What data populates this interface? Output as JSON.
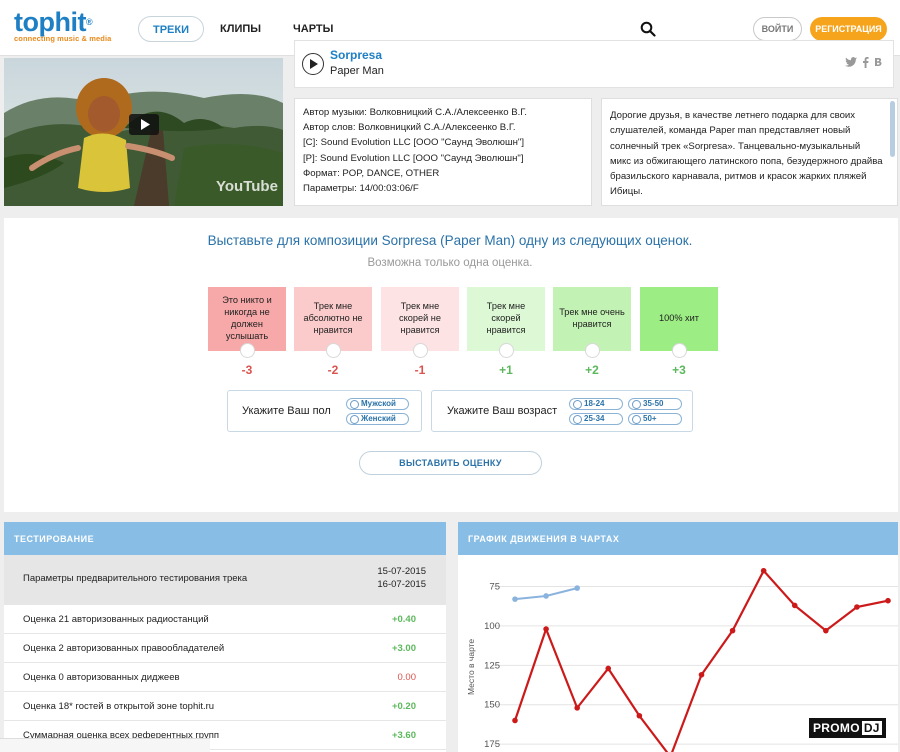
{
  "header": {
    "logo": "tophit",
    "logo_tagline": "connecting music & media",
    "nav": [
      "ТРЕКИ",
      "КЛИПЫ",
      "ЧАРТЫ"
    ],
    "login_label": "ВОЙТИ",
    "register_label": "РЕГИСТРАЦИЯ",
    "accent_color": "#1e7fc4",
    "register_color": "#f7a41d"
  },
  "video": {
    "watermark": "YouTube"
  },
  "track": {
    "title": "Sorpresa",
    "artist": "Paper Man",
    "share_icons": [
      "twitter-icon",
      "facebook-icon",
      "vk-icon"
    ]
  },
  "info": [
    "Автор музыки: Волковницкий С.А./Алексеенко В.Г.",
    "Автор слов: Волковницкий С.А./Алексеенко В.Г.",
    "[C]: Sound Evolution LLC [ООО \"Саунд Эволюшн\"]",
    "[P]: Sound Evolution LLC [ООО \"Саунд Эволюшн\"]",
    "Формат: POP, DANCE, OTHER",
    "Параметры: 14/00:03:06/F"
  ],
  "description": "Дорогие друзья, в качестве летнего подарка для своих слушателей, команда Paper man представляет новый солнечный трек «Sorpresa». Танцевально-музыкальный микс из обжигающего латинского попа, безудержного драйва бразильского карнавала, ритмов и красок жарких пляжей Ибицы.",
  "rating": {
    "title": "Выставьте для композиции Sorpresa (Paper Man) одну из следующих оценок.",
    "subtitle": "Возможна только одна оценка.",
    "options": [
      {
        "label": "Это никто и никогда не должен услышать",
        "score": "-3",
        "color": "#f7a8a8"
      },
      {
        "label": "Трек мне абсолютно не нравится",
        "score": "-2",
        "color": "#fbcaca"
      },
      {
        "label": "Трек мне скорей не нравится",
        "score": "-1",
        "color": "#fde3e3"
      },
      {
        "label": "Трек мне скорей нравится",
        "score": "+1",
        "color": "#dcf8d4"
      },
      {
        "label": "Трек мне очень нравится",
        "score": "+2",
        "color": "#c3f3b4"
      },
      {
        "label": "100% хит",
        "score": "+3",
        "color": "#9ced84"
      }
    ],
    "gender_label": "Укажите Ваш пол",
    "gender_options": [
      "Мужской",
      "Женский"
    ],
    "age_label": "Укажите Ваш возраст",
    "age_options": [
      "18-24",
      "35-50",
      "25-34",
      "50+"
    ],
    "submit_label": "ВЫСТАВИТЬ ОЦЕНКУ"
  },
  "testing": {
    "title": "ТЕСТИРОВАНИЕ",
    "header_row": {
      "label": "Параметры предварительного тестирования трека",
      "date_from": "15-07-2015",
      "date_to": "16-07-2015"
    },
    "rows": [
      {
        "label": "Оценка 21 авторизованных радиостанций",
        "value": "+0.40"
      },
      {
        "label": "Оценка 2 авторизованных правообладателей",
        "value": "+3.00"
      },
      {
        "label": "Оценка 0 авторизованных диджеев",
        "value": "0.00"
      },
      {
        "label": "Оценка 18* гостей в открытой зоне tophit.ru",
        "value": "+0.20"
      },
      {
        "label": "Суммарная оценка всех референтных групп",
        "value": "+3.60"
      }
    ]
  },
  "chart_panel": {
    "title": "ГРАФИК ДВИЖЕНИЯ В ЧАРТАХ",
    "badge": [
      "PROMO",
      "DJ"
    ]
  },
  "chart_data": {
    "type": "line",
    "ylabel": "Место в чарте",
    "yticks": [
      75,
      100,
      125,
      150,
      175
    ],
    "ylim": [
      55,
      180
    ],
    "y_inverted": true,
    "grid": true,
    "series": [
      {
        "color": "#8ab3de",
        "points": [
          [
            0,
            83
          ],
          [
            1,
            81
          ],
          [
            2,
            76
          ]
        ]
      },
      {
        "color": "#cc1a1a",
        "points": [
          [
            0,
            160
          ],
          [
            1,
            102
          ],
          [
            2,
            152
          ],
          [
            3,
            127
          ],
          [
            4,
            157
          ],
          [
            5,
            183
          ],
          [
            6,
            131
          ],
          [
            7,
            103
          ],
          [
            8,
            65
          ],
          [
            9,
            87
          ],
          [
            10,
            103
          ],
          [
            11,
            88
          ],
          [
            12,
            84
          ]
        ]
      }
    ]
  }
}
